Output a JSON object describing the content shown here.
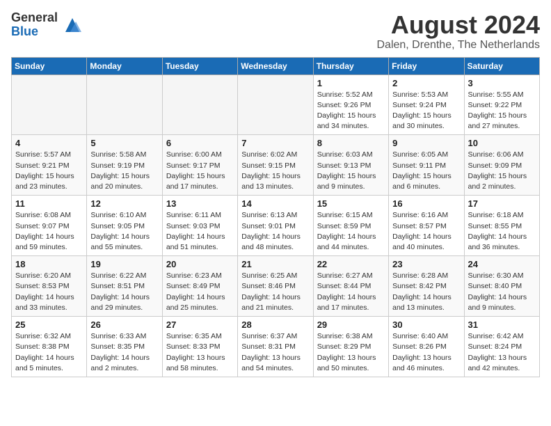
{
  "header": {
    "logo_general": "General",
    "logo_blue": "Blue",
    "month_title": "August 2024",
    "location": "Dalen, Drenthe, The Netherlands"
  },
  "weekdays": [
    "Sunday",
    "Monday",
    "Tuesday",
    "Wednesday",
    "Thursday",
    "Friday",
    "Saturday"
  ],
  "weeks": [
    [
      {
        "day": "",
        "info": ""
      },
      {
        "day": "",
        "info": ""
      },
      {
        "day": "",
        "info": ""
      },
      {
        "day": "",
        "info": ""
      },
      {
        "day": "1",
        "info": "Sunrise: 5:52 AM\nSunset: 9:26 PM\nDaylight: 15 hours\nand 34 minutes."
      },
      {
        "day": "2",
        "info": "Sunrise: 5:53 AM\nSunset: 9:24 PM\nDaylight: 15 hours\nand 30 minutes."
      },
      {
        "day": "3",
        "info": "Sunrise: 5:55 AM\nSunset: 9:22 PM\nDaylight: 15 hours\nand 27 minutes."
      }
    ],
    [
      {
        "day": "4",
        "info": "Sunrise: 5:57 AM\nSunset: 9:21 PM\nDaylight: 15 hours\nand 23 minutes."
      },
      {
        "day": "5",
        "info": "Sunrise: 5:58 AM\nSunset: 9:19 PM\nDaylight: 15 hours\nand 20 minutes."
      },
      {
        "day": "6",
        "info": "Sunrise: 6:00 AM\nSunset: 9:17 PM\nDaylight: 15 hours\nand 17 minutes."
      },
      {
        "day": "7",
        "info": "Sunrise: 6:02 AM\nSunset: 9:15 PM\nDaylight: 15 hours\nand 13 minutes."
      },
      {
        "day": "8",
        "info": "Sunrise: 6:03 AM\nSunset: 9:13 PM\nDaylight: 15 hours\nand 9 minutes."
      },
      {
        "day": "9",
        "info": "Sunrise: 6:05 AM\nSunset: 9:11 PM\nDaylight: 15 hours\nand 6 minutes."
      },
      {
        "day": "10",
        "info": "Sunrise: 6:06 AM\nSunset: 9:09 PM\nDaylight: 15 hours\nand 2 minutes."
      }
    ],
    [
      {
        "day": "11",
        "info": "Sunrise: 6:08 AM\nSunset: 9:07 PM\nDaylight: 14 hours\nand 59 minutes."
      },
      {
        "day": "12",
        "info": "Sunrise: 6:10 AM\nSunset: 9:05 PM\nDaylight: 14 hours\nand 55 minutes."
      },
      {
        "day": "13",
        "info": "Sunrise: 6:11 AM\nSunset: 9:03 PM\nDaylight: 14 hours\nand 51 minutes."
      },
      {
        "day": "14",
        "info": "Sunrise: 6:13 AM\nSunset: 9:01 PM\nDaylight: 14 hours\nand 48 minutes."
      },
      {
        "day": "15",
        "info": "Sunrise: 6:15 AM\nSunset: 8:59 PM\nDaylight: 14 hours\nand 44 minutes."
      },
      {
        "day": "16",
        "info": "Sunrise: 6:16 AM\nSunset: 8:57 PM\nDaylight: 14 hours\nand 40 minutes."
      },
      {
        "day": "17",
        "info": "Sunrise: 6:18 AM\nSunset: 8:55 PM\nDaylight: 14 hours\nand 36 minutes."
      }
    ],
    [
      {
        "day": "18",
        "info": "Sunrise: 6:20 AM\nSunset: 8:53 PM\nDaylight: 14 hours\nand 33 minutes."
      },
      {
        "day": "19",
        "info": "Sunrise: 6:22 AM\nSunset: 8:51 PM\nDaylight: 14 hours\nand 29 minutes."
      },
      {
        "day": "20",
        "info": "Sunrise: 6:23 AM\nSunset: 8:49 PM\nDaylight: 14 hours\nand 25 minutes."
      },
      {
        "day": "21",
        "info": "Sunrise: 6:25 AM\nSunset: 8:46 PM\nDaylight: 14 hours\nand 21 minutes."
      },
      {
        "day": "22",
        "info": "Sunrise: 6:27 AM\nSunset: 8:44 PM\nDaylight: 14 hours\nand 17 minutes."
      },
      {
        "day": "23",
        "info": "Sunrise: 6:28 AM\nSunset: 8:42 PM\nDaylight: 14 hours\nand 13 minutes."
      },
      {
        "day": "24",
        "info": "Sunrise: 6:30 AM\nSunset: 8:40 PM\nDaylight: 14 hours\nand 9 minutes."
      }
    ],
    [
      {
        "day": "25",
        "info": "Sunrise: 6:32 AM\nSunset: 8:38 PM\nDaylight: 14 hours\nand 5 minutes."
      },
      {
        "day": "26",
        "info": "Sunrise: 6:33 AM\nSunset: 8:35 PM\nDaylight: 14 hours\nand 2 minutes."
      },
      {
        "day": "27",
        "info": "Sunrise: 6:35 AM\nSunset: 8:33 PM\nDaylight: 13 hours\nand 58 minutes."
      },
      {
        "day": "28",
        "info": "Sunrise: 6:37 AM\nSunset: 8:31 PM\nDaylight: 13 hours\nand 54 minutes."
      },
      {
        "day": "29",
        "info": "Sunrise: 6:38 AM\nSunset: 8:29 PM\nDaylight: 13 hours\nand 50 minutes."
      },
      {
        "day": "30",
        "info": "Sunrise: 6:40 AM\nSunset: 8:26 PM\nDaylight: 13 hours\nand 46 minutes."
      },
      {
        "day": "31",
        "info": "Sunrise: 6:42 AM\nSunset: 8:24 PM\nDaylight: 13 hours\nand 42 minutes."
      }
    ]
  ]
}
